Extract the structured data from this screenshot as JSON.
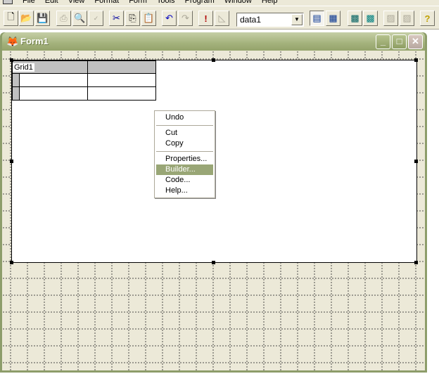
{
  "menubar": [
    "File",
    "Edit",
    "View",
    "Format",
    "Form",
    "Tools",
    "Program",
    "Window",
    "Help"
  ],
  "toolbar": {
    "datasource": "data1"
  },
  "form": {
    "title": "Form1"
  },
  "grid": {
    "name": "Grid1"
  },
  "context_menu": [
    {
      "label": "Undo",
      "ul": "U"
    },
    {
      "label": "Cut",
      "ul": "t"
    },
    {
      "label": "Copy",
      "ul": "C"
    },
    {
      "label": "Properties...",
      "ul": "P"
    },
    {
      "label": "Builder...",
      "ul": "B",
      "highlighted": true
    },
    {
      "label": "Code...",
      "ul": "o"
    },
    {
      "label": "Help...",
      "ul": "H"
    }
  ]
}
